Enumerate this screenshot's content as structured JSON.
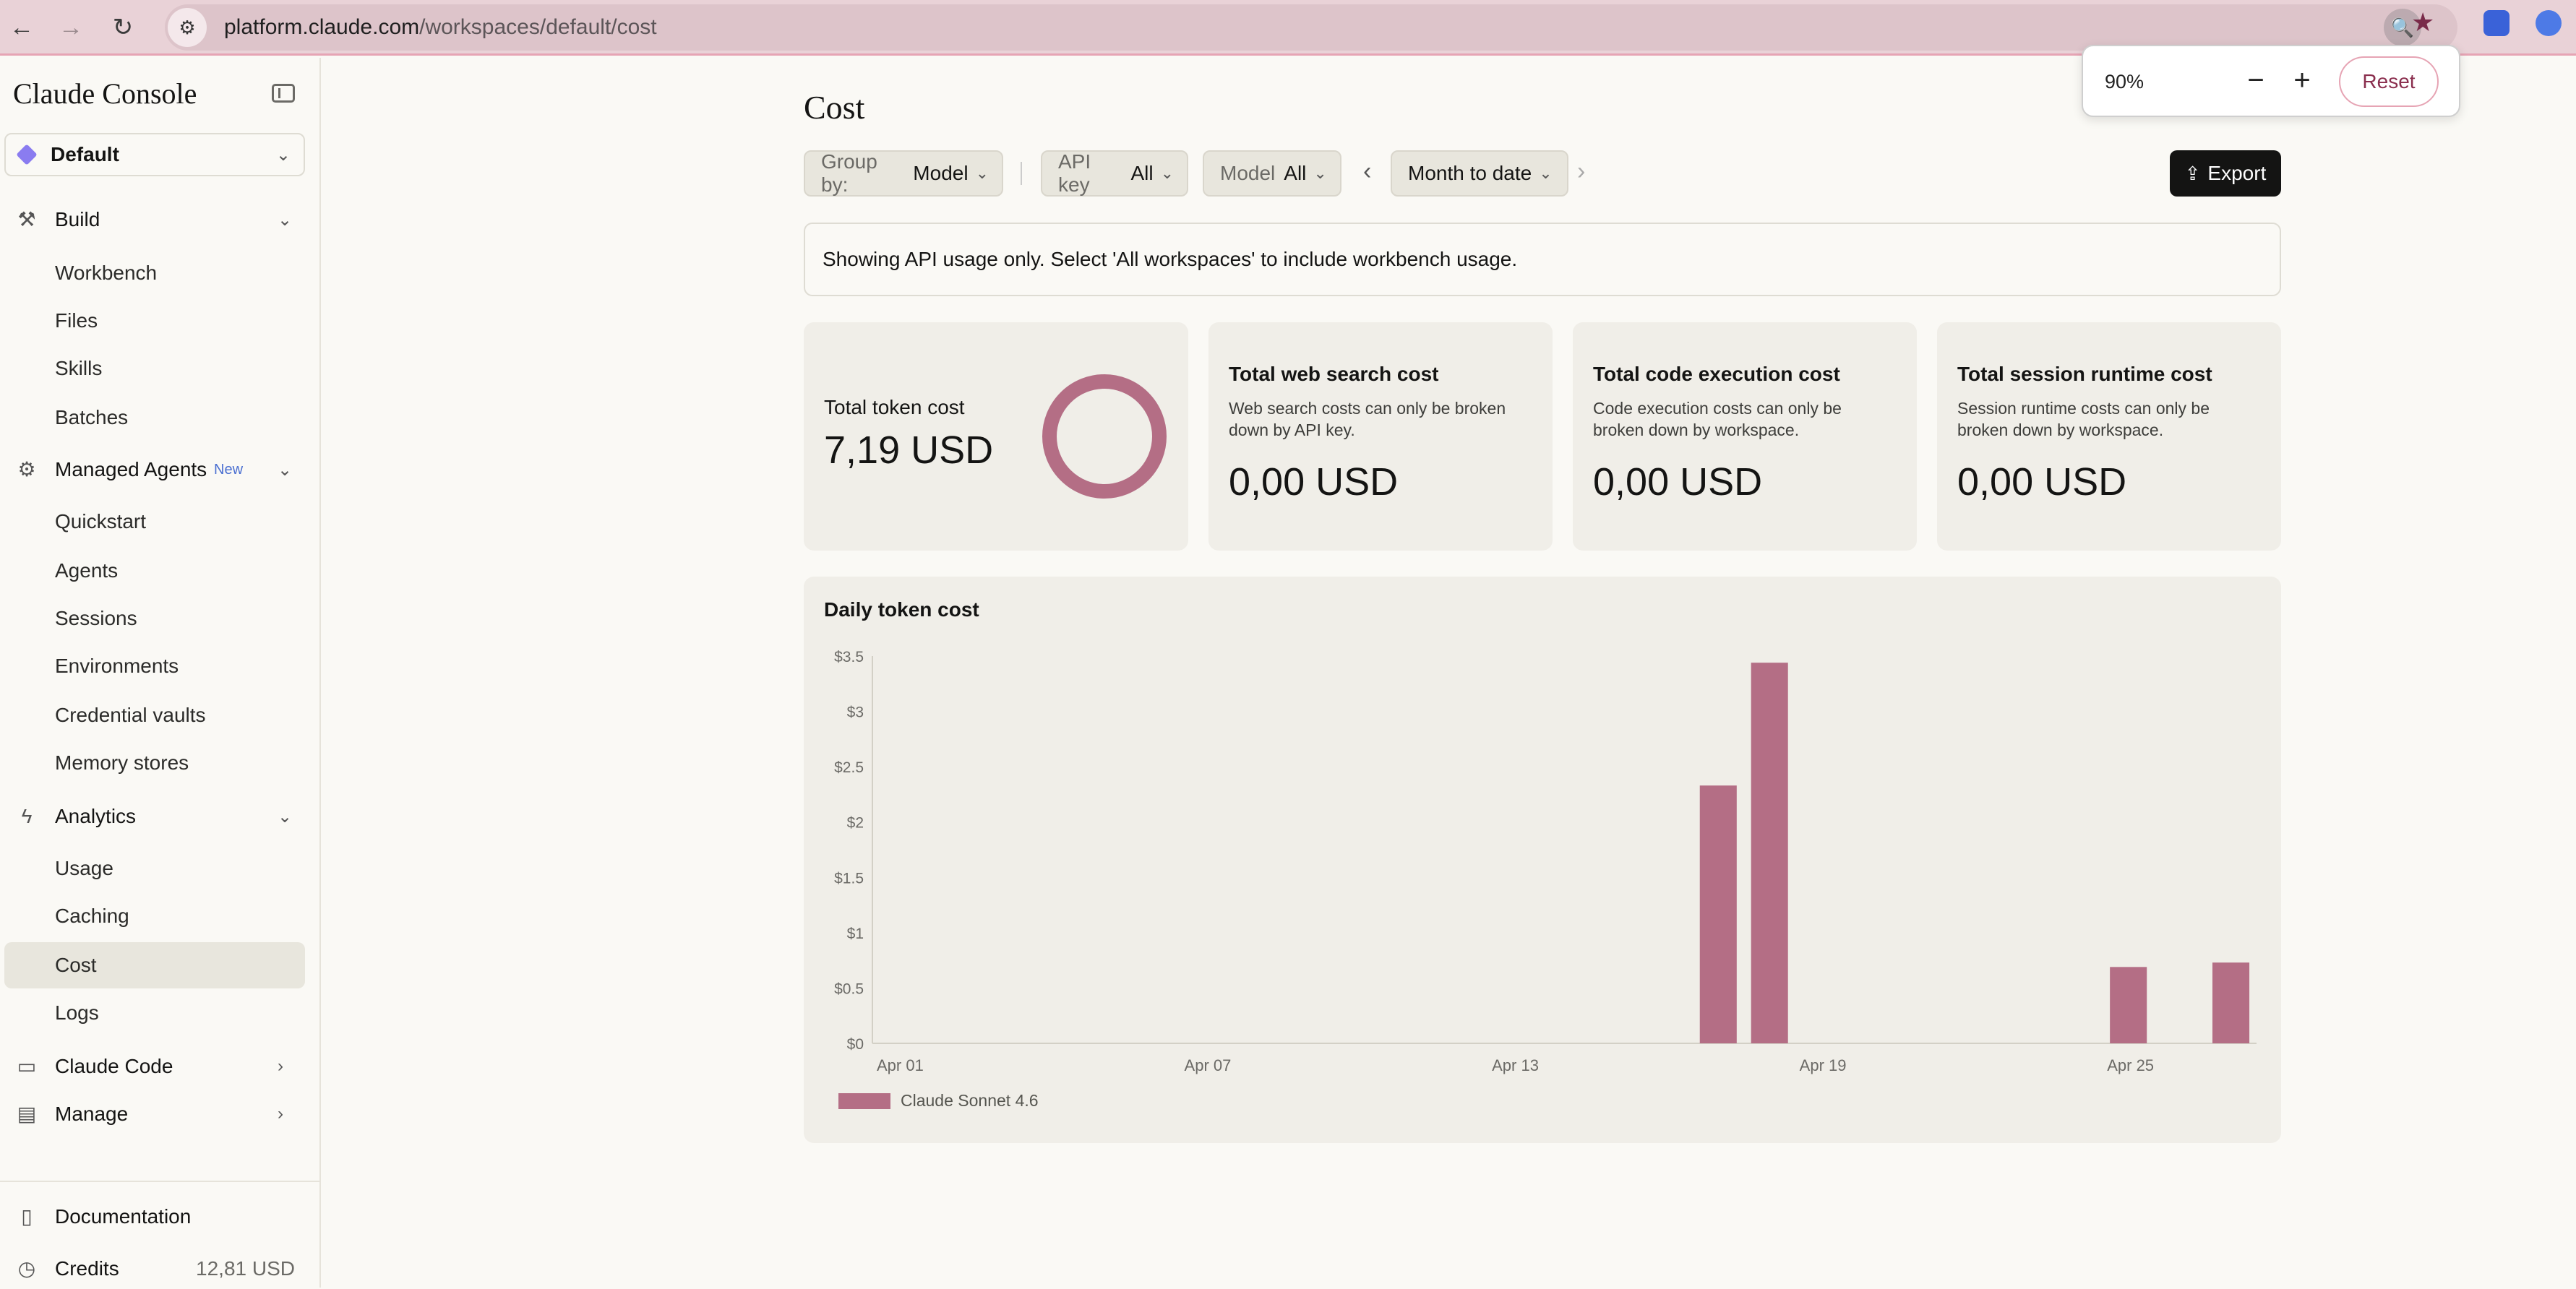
{
  "browser": {
    "url_host": "platform.claude.com",
    "url_path": "/workspaces/default/cost",
    "zoom_popup": {
      "zoom_level": "90%",
      "reset_label": "Reset"
    }
  },
  "sidebar": {
    "brand": "Claude Console",
    "workspace": "Default",
    "sections": {
      "build": {
        "label": "Build",
        "items": [
          "Workbench",
          "Files",
          "Skills",
          "Batches"
        ]
      },
      "managed_agents": {
        "label": "Managed Agents",
        "badge": "New",
        "items": [
          "Quickstart",
          "Agents",
          "Sessions",
          "Environments",
          "Credential vaults",
          "Memory stores"
        ]
      },
      "analytics": {
        "label": "Analytics",
        "items": [
          "Usage",
          "Caching",
          "Cost",
          "Logs"
        ]
      },
      "claude_code": {
        "label": "Claude Code"
      },
      "manage": {
        "label": "Manage"
      }
    },
    "footer": {
      "documentation": "Documentation",
      "credits_label": "Credits",
      "credits_value": "12,81 USD"
    }
  },
  "main": {
    "title": "Cost",
    "filters": {
      "group_by_key": "Group by:",
      "group_by_value": "Model",
      "api_key_key": "API key",
      "api_key_value": "All",
      "model_key": "Model",
      "model_value": "All",
      "date_range": "Month to date"
    },
    "export_label": "Export",
    "notice": "Showing API usage only. Select 'All workspaces' to include workbench usage.",
    "cards": {
      "token": {
        "title": "Total token cost",
        "value": "7,19 USD"
      },
      "web_search": {
        "title": "Total web search cost",
        "desc": "Web search costs can only be broken down by API key.",
        "value": "0,00 USD"
      },
      "code_exec": {
        "title": "Total code execution cost",
        "desc": "Code execution costs can only be broken down by workspace.",
        "value": "0,00 USD"
      },
      "session": {
        "title": "Total session runtime cost",
        "desc": "Session runtime costs can only be broken down by workspace.",
        "value": "0,00 USD"
      }
    },
    "chart_title": "Daily token cost"
  },
  "colors": {
    "accent": "#b46e85",
    "browser_bar": "#e9d2d7",
    "sidebar_active": "#e8e6dd",
    "card_bg": "#f0eee8",
    "export_bg": "#141413"
  },
  "chart_data": {
    "type": "bar",
    "title": "Daily token cost",
    "xlabel": "",
    "ylabel": "",
    "x": [
      "Apr 01",
      "Apr 02",
      "Apr 03",
      "Apr 04",
      "Apr 05",
      "Apr 06",
      "Apr 07",
      "Apr 08",
      "Apr 09",
      "Apr 10",
      "Apr 11",
      "Apr 12",
      "Apr 13",
      "Apr 14",
      "Apr 15",
      "Apr 16",
      "Apr 17",
      "Apr 18",
      "Apr 19",
      "Apr 20",
      "Apr 21",
      "Apr 22",
      "Apr 23",
      "Apr 24",
      "Apr 25",
      "Apr 26",
      "Apr 27"
    ],
    "x_tick_labels": [
      "Apr 01",
      "Apr 07",
      "Apr 13",
      "Apr 19",
      "Apr 25"
    ],
    "y_tick_labels": [
      "$0",
      "$0.5",
      "$1",
      "$1.5",
      "$2",
      "$2.5",
      "$3",
      "$3.5"
    ],
    "ylim": [
      0,
      3.5
    ],
    "series": [
      {
        "name": "Claude Sonnet 4.6",
        "color": "#b46e85",
        "values": [
          0,
          0,
          0,
          0,
          0,
          0,
          0,
          0,
          0,
          0,
          0,
          0,
          0,
          0,
          0,
          0,
          2.33,
          3.44,
          0,
          0,
          0,
          0,
          0,
          0,
          0.69,
          0,
          0.73
        ]
      }
    ],
    "grid": false,
    "legend": "bottom-left"
  }
}
